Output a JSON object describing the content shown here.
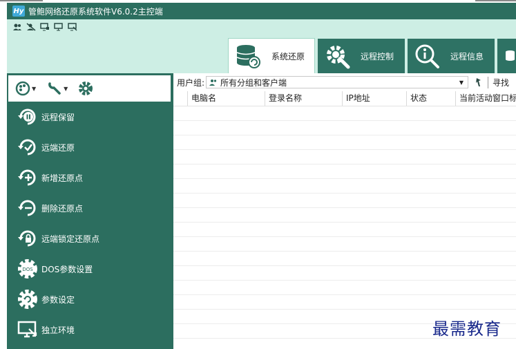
{
  "window": {
    "logo_text": "Hy",
    "title": "管鲍网络还原系统软件V6.0.2主控端"
  },
  "quick_icons": [
    "users-icon",
    "hide-icon",
    "monitor-lock-icon",
    "monitor-icon",
    "monitor-link-icon"
  ],
  "tabs": [
    {
      "label": "系统还原",
      "icon": "database-restore-icon",
      "active": true
    },
    {
      "label": "远程控制",
      "icon": "gear-wrench-icon",
      "active": false
    },
    {
      "label": "远程信息",
      "icon": "info-search-icon",
      "active": false
    },
    {
      "label": "",
      "icon": "database-icon",
      "active": false
    }
  ],
  "sidebar": {
    "items": [
      {
        "label": "远程保留",
        "icon": "pause-cycle-icon"
      },
      {
        "label": "远端还原",
        "icon": "check-cycle-icon"
      },
      {
        "label": "新增还原点",
        "icon": "plus-cycle-icon"
      },
      {
        "label": "删除还原点",
        "icon": "minus-cycle-icon"
      },
      {
        "label": "远端锁定还原点",
        "icon": "lock-cycle-icon"
      },
      {
        "label": "DOS参数设置",
        "icon": "dos-gear-icon"
      },
      {
        "label": "参数设定",
        "icon": "settings-gear-icon"
      },
      {
        "label": "独立环境",
        "icon": "monitor-arrow-icon"
      }
    ],
    "dos_badge": "DOS"
  },
  "filter": {
    "label": "用户组:",
    "value": "所有分组和客户端",
    "search_label": "寻找"
  },
  "table": {
    "columns": [
      "电脑名",
      "登录名称",
      "IP地址",
      "状态",
      "当前活动窗口标"
    ],
    "rows": []
  },
  "watermark": "最需教育",
  "colors": {
    "primary": "#2c6e5f",
    "header_bg": "#cdeee4",
    "accent": "#3fa9d8"
  }
}
